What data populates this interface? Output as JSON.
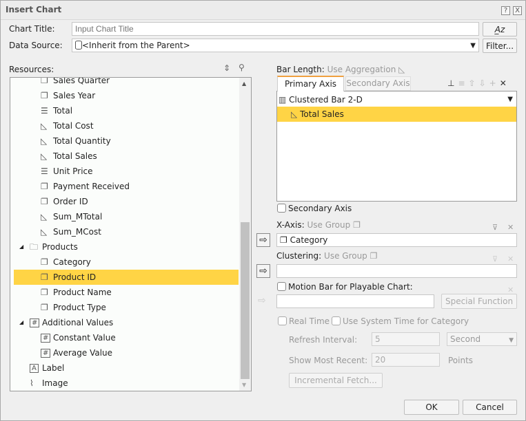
{
  "dialog": {
    "title": "Insert Chart",
    "help": "?",
    "close": "X"
  },
  "chart_title": {
    "label": "Chart Title:",
    "placeholder": "Input Chart Title",
    "value": ""
  },
  "data_source": {
    "label": "Data Source:",
    "value": "<Inherit from the Parent>",
    "filter_button": "Filter..."
  },
  "resources": {
    "label": "Resources:",
    "items": [
      {
        "label": "Sales Quarter",
        "icon": "group-icon",
        "level": 2
      },
      {
        "label": "Sales Year",
        "icon": "group-icon",
        "level": 2
      },
      {
        "label": "Total",
        "icon": "detail-icon",
        "level": 2
      },
      {
        "label": "Total Cost",
        "icon": "aggregation-icon",
        "level": 2
      },
      {
        "label": "Total Quantity",
        "icon": "aggregation-icon",
        "level": 2
      },
      {
        "label": "Total Sales",
        "icon": "aggregation-icon",
        "level": 2
      },
      {
        "label": "Unit Price",
        "icon": "detail-icon",
        "level": 2
      },
      {
        "label": "Payment Received",
        "icon": "group-icon",
        "level": 2
      },
      {
        "label": "Order ID",
        "icon": "group-icon",
        "level": 2
      },
      {
        "label": "Sum_MTotal",
        "icon": "aggregation-icon",
        "level": 2
      },
      {
        "label": "Sum_MCost",
        "icon": "aggregation-icon",
        "level": 2
      },
      {
        "label": "Products",
        "icon": "folder-icon",
        "level": 1,
        "expanded": true
      },
      {
        "label": "Category",
        "icon": "group-icon",
        "level": 2
      },
      {
        "label": "Product ID",
        "icon": "group-icon",
        "level": 2,
        "selected": true
      },
      {
        "label": "Product Name",
        "icon": "group-icon",
        "level": 2
      },
      {
        "label": "Product Type",
        "icon": "group-icon",
        "level": 2
      },
      {
        "label": "Additional Values",
        "icon": "hash-icon",
        "level": 1,
        "expanded": true
      },
      {
        "label": "Constant Value",
        "icon": "hash-icon",
        "level": 2
      },
      {
        "label": "Average Value",
        "icon": "hash-icon",
        "level": 2
      },
      {
        "label": "Label",
        "icon": "label-icon",
        "level": 1
      },
      {
        "label": "Image",
        "icon": "image-icon",
        "level": 1
      }
    ]
  },
  "bar_length": {
    "label": "Bar Length:",
    "value": "Use Aggregation"
  },
  "tabs": [
    {
      "label": "Primary Axis",
      "active": true
    },
    {
      "label": "Secondary Axis",
      "active": false
    }
  ],
  "chart_type": "Clustered Bar 2-D",
  "measures": [
    {
      "label": "Total Sales",
      "selected": true
    }
  ],
  "secondary_axis_checkbox": "Secondary Axis",
  "x_axis": {
    "label": "X-Axis:",
    "hint": "Use Group",
    "value": "Category"
  },
  "clustering": {
    "label": "Clustering:",
    "hint": "Use Group",
    "value": ""
  },
  "motion_bar": {
    "label": "Motion Bar for Playable Chart:",
    "value": "",
    "special_function": "Special Function"
  },
  "real_time": {
    "label": "Real Time",
    "use_system_time": "Use System Time for Category",
    "refresh_label": "Refresh Interval:",
    "refresh_value": "5",
    "refresh_unit": "Second",
    "recent_label": "Show Most Recent:",
    "recent_value": "20",
    "recent_unit": "Points",
    "incremental": "Incremental Fetch..."
  },
  "footer": {
    "ok": "OK",
    "cancel": "Cancel"
  },
  "colors": {
    "selection": "#ffd445",
    "tab_accent": "#f0a040"
  }
}
